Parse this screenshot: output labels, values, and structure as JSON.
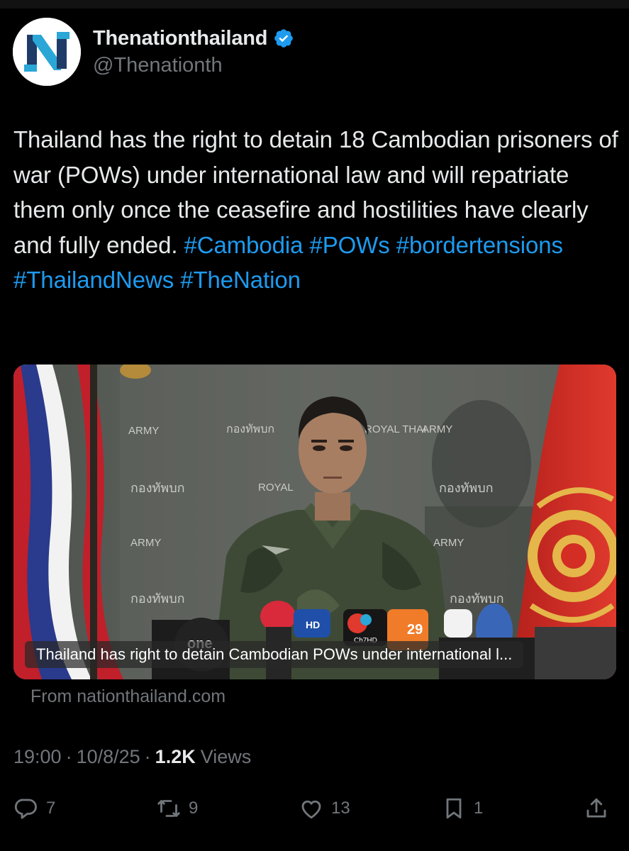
{
  "post": {
    "author": {
      "display_name": "Thenationthailand",
      "handle": "@Thenationth",
      "verified": true,
      "avatar_icon": "nation-logo-icon"
    },
    "text": {
      "body": "Thailand has the right to detain 18 Cambodian prisoners of war (POWs) under international law and will repatriate them only once the ceasefire and hostilities have clearly and fully ended.",
      "hashtags": [
        "#Cambodia",
        "#POWs",
        "#bordertensions",
        "#ThailandNews",
        "#TheNation"
      ]
    },
    "media": {
      "caption": "Thailand has right to detain Cambodian POWs under international l...",
      "source": "From nationthailand.com",
      "visible_text": {
        "wall_army": "ARMY",
        "wall_royal": "ROYAL",
        "wall_royal_thai": "ROYAL THAI",
        "wall_thai": "กองทัพบก",
        "mic_one": "one",
        "mic_ch7": "Ch7HD",
        "mic_29": "29",
        "mic_hd": "HD"
      }
    },
    "meta": {
      "time": "19:00",
      "date": "10/8/25",
      "views_count": "1.2K",
      "views_label": "Views"
    },
    "actions": {
      "replies": "7",
      "reposts": "9",
      "likes": "13",
      "bookmarks": "1"
    },
    "colors": {
      "background": "#000000",
      "text": "#e7e9ea",
      "muted": "#71767b",
      "accent": "#1d9bf0"
    }
  }
}
